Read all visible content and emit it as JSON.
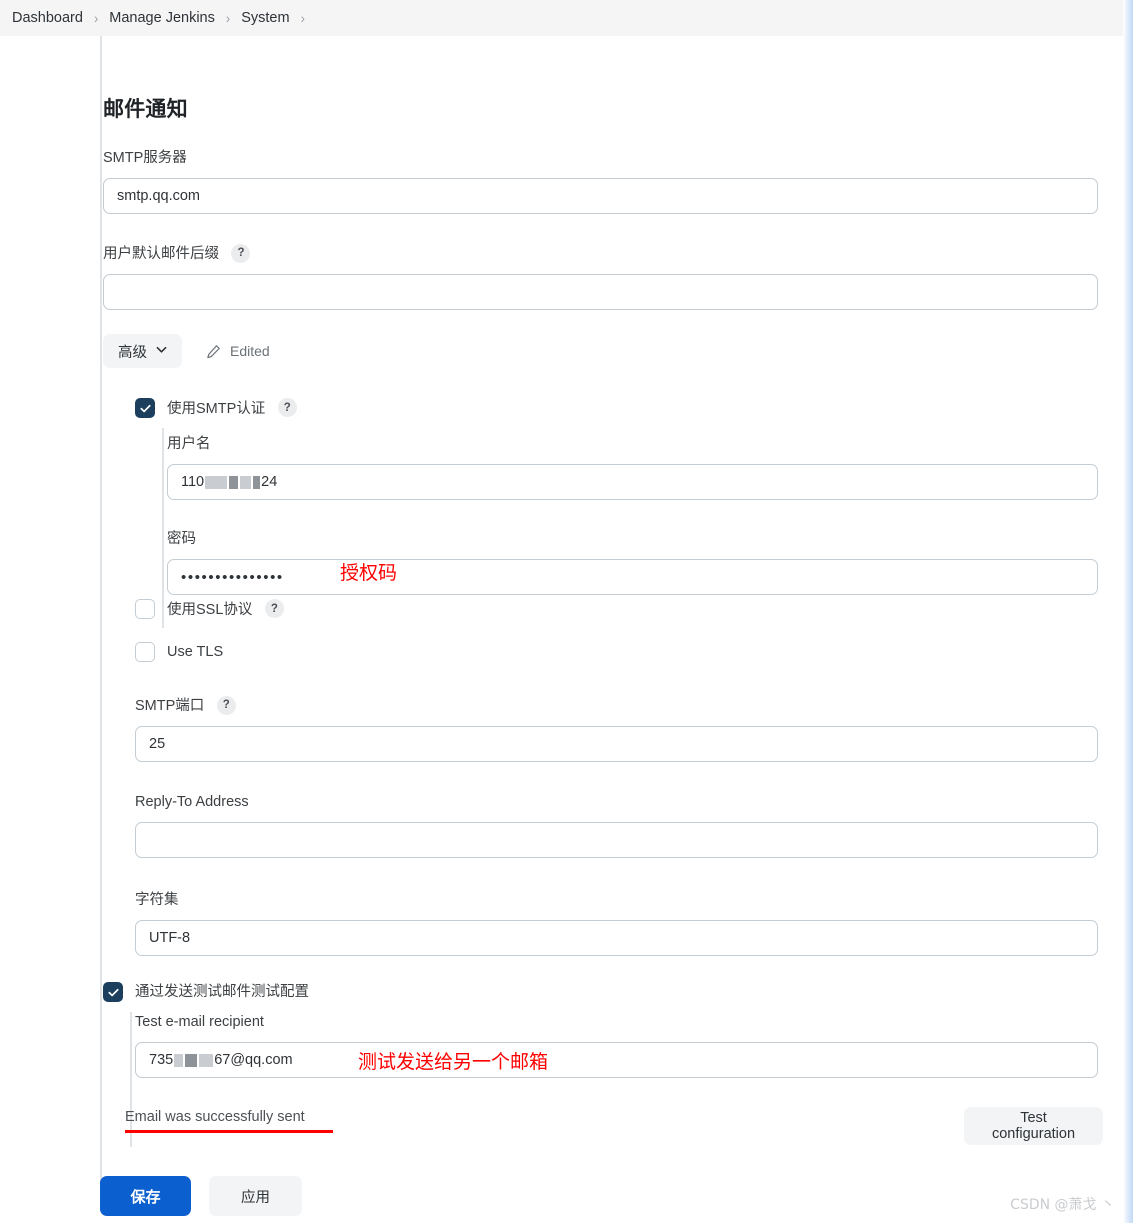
{
  "breadcrumb": {
    "items": [
      {
        "label": "Dashboard"
      },
      {
        "label": "Manage Jenkins"
      },
      {
        "label": "System"
      }
    ],
    "separator": "›"
  },
  "section": {
    "title": "邮件通知"
  },
  "fields": {
    "smtp_server": {
      "label": "SMTP服务器",
      "value": "smtp.qq.com"
    },
    "default_suffix": {
      "label": "用户默认邮件后缀",
      "help": "?",
      "value": ""
    },
    "username": {
      "label": "用户名",
      "value_prefix": "110",
      "value_suffix": "24"
    },
    "password": {
      "label": "密码",
      "value": "•••••••••••••••"
    },
    "smtp_port": {
      "label": "SMTP端口",
      "help": "?",
      "value": "25"
    },
    "reply_to": {
      "label": "Reply-To Address",
      "value": ""
    },
    "charset": {
      "label": "字符集",
      "value": "UTF-8"
    },
    "test_recipient": {
      "label": "Test e-mail recipient",
      "value_prefix": "735",
      "value_suffix": "67@qq.com"
    }
  },
  "advanced": {
    "button_label": "高级",
    "chevron_icon": "chevron-down-icon",
    "edited_label": "Edited",
    "edited_icon": "pencil-icon"
  },
  "checkboxes": {
    "use_smtp_auth": {
      "label": "使用SMTP认证",
      "help": "?",
      "checked": true
    },
    "use_ssl": {
      "label": "使用SSL协议",
      "help": "?",
      "checked": false
    },
    "use_tls": {
      "label": "Use TLS",
      "checked": false
    },
    "test_config": {
      "label": "通过发送测试邮件测试配置",
      "checked": true
    }
  },
  "status": {
    "email_sent": "Email was successfully sent"
  },
  "buttons": {
    "test_configuration": "Test configuration",
    "save": "保存",
    "apply": "应用"
  },
  "annotations": {
    "password_note": "授权码",
    "recipient_note": "测试发送给另一个邮箱"
  },
  "watermark": "CSDN @萧戈 丶",
  "colors": {
    "accent_blue": "#0b5fce",
    "checkbox_checked": "#1c3f5e",
    "annotation_red": "#ff0000",
    "border": "#c4cdd4"
  }
}
